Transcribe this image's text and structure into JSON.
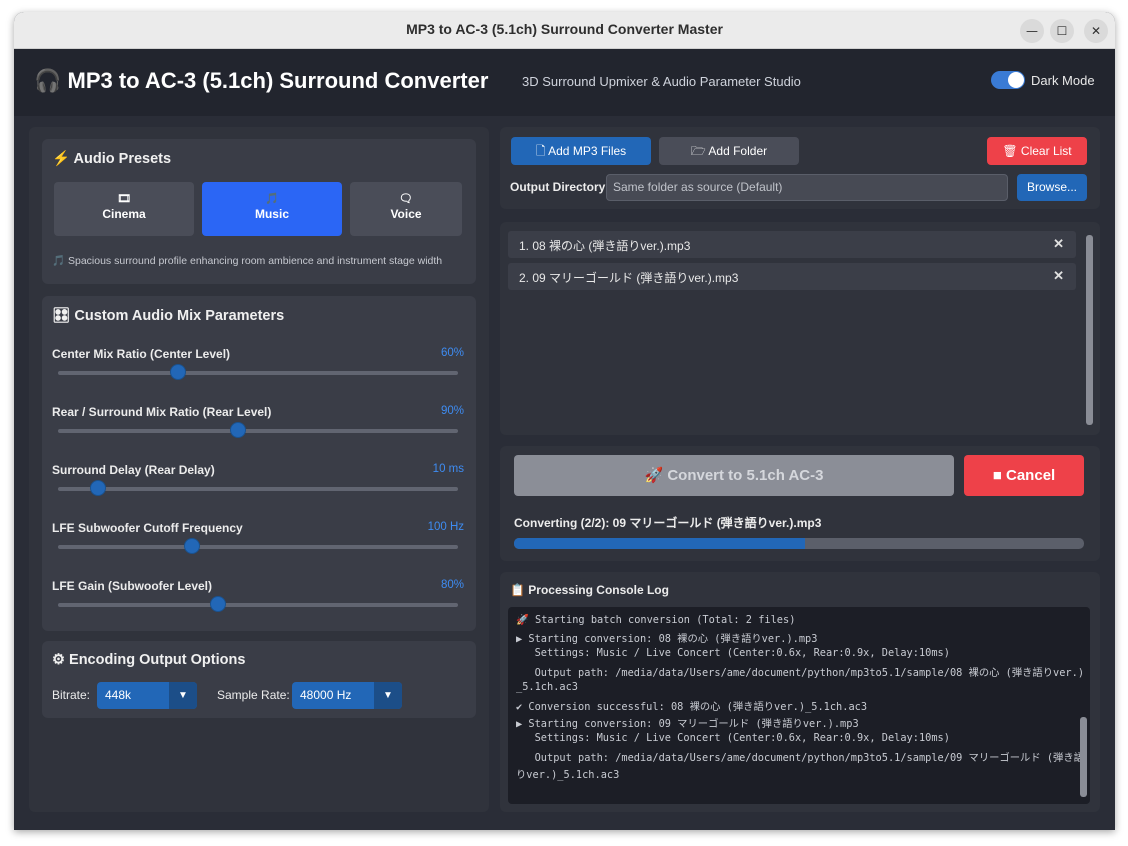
{
  "window": {
    "title": "MP3 to AC-3 (5.1ch) Surround Converter Master"
  },
  "header": {
    "icon": "headphones-icon",
    "title": "🎧 MP3 to AC-3 (5.1ch) Surround Converter",
    "subtitle": "3D Surround Upmixer & Audio Parameter Studio",
    "dark_mode_label": "Dark Mode",
    "dark_mode_on": true
  },
  "presets": {
    "title": "⚡ Audio Presets",
    "items": [
      {
        "icon": "🎞",
        "label": "Cinema",
        "active": false
      },
      {
        "icon": "🎵",
        "label": "Music",
        "active": true
      },
      {
        "icon": "🗨",
        "label": "Voice",
        "active": false
      }
    ],
    "description": "🎵 Spacious surround profile enhancing room ambience and instrument stage width"
  },
  "mix": {
    "title": "🎛 Custom Audio Mix Parameters",
    "params": [
      {
        "label": "Center Mix Ratio (Center Level)",
        "value": "60%",
        "fraction": 0.3
      },
      {
        "label": "Rear / Surround Mix Ratio (Rear Level)",
        "value": "90%",
        "fraction": 0.45
      },
      {
        "label": "Surround Delay (Rear Delay)",
        "value": "10 ms",
        "fraction": 0.1
      },
      {
        "label": "LFE Subwoofer Cutoff Frequency",
        "value": "100 Hz",
        "fraction": 0.335
      },
      {
        "label": "LFE Gain (Subwoofer Level)",
        "value": "80%",
        "fraction": 0.4
      }
    ]
  },
  "encoding": {
    "title": "⚙ Encoding Output Options",
    "bitrate_label": "Bitrate:",
    "bitrate_value": "448k",
    "samplerate_label": "Sample Rate:",
    "samplerate_value": "48000 Hz"
  },
  "toolbar": {
    "add_files": "🗋 Add MP3 Files",
    "add_folder": "🗁 Add Folder",
    "clear_list": "🗑 Clear List",
    "output_dir_label": "Output Directory:",
    "output_dir_value": "Same folder as source (Default)",
    "browse": "Browse..."
  },
  "files": [
    "1. 08 裸の心 (弾き語りver.).mp3",
    "2. 09 マリーゴールド (弾き語りver.).mp3"
  ],
  "conversion": {
    "convert_label": "🚀 Convert to 5.1ch AC-3",
    "cancel_label": "■ Cancel",
    "status": "Converting (2/2): 09 マリーゴールド (弾き語りver.).mp3",
    "progress": 0.51
  },
  "console": {
    "title": "📋 Processing Console Log",
    "lines": [
      "🚀 Starting batch conversion (Total: 2 files)",
      "▶ Starting conversion: 08 裸の心 (弾き語りver.).mp3",
      "   Settings: Music / Live Concert (Center:0.6x, Rear:0.9x, Delay:10ms)",
      "   Output path: /media/data/Users/ame/document/python/mp3to5.1/sample/08 裸の心 (弾き語りver.)",
      "_5.1ch.ac3",
      "✔ Conversion successful: 08 裸の心 (弾き語りver.)_5.1ch.ac3",
      "▶ Starting conversion: 09 マリーゴールド (弾き語りver.).mp3",
      "   Settings: Music / Live Concert (Center:0.6x, Rear:0.9x, Delay:10ms)",
      "   Output path: /media/data/Users/ame/document/python/mp3to5.1/sample/09 マリーゴールド (弾き語",
      "りver.)_5.1ch.ac3"
    ]
  },
  "colors": {
    "accent": "#2267b7",
    "active_preset": "#2b66f5",
    "danger": "#ee4149",
    "value_text": "#3e8cf2"
  }
}
